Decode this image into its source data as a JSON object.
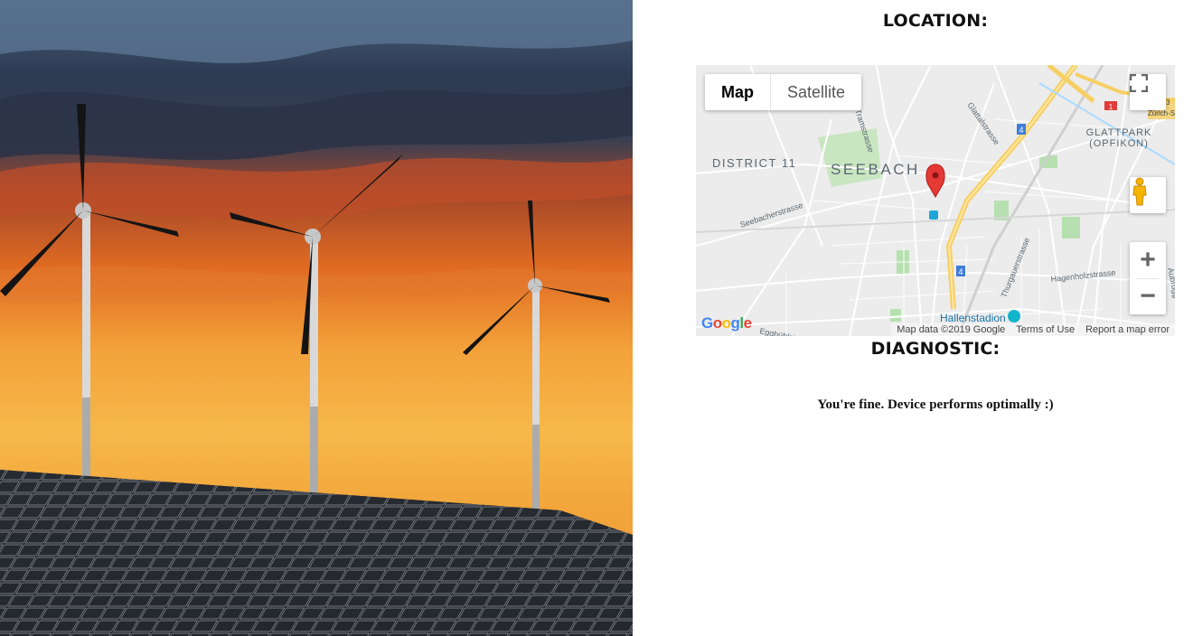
{
  "location_heading": "LOCATION:",
  "diagnostic_heading": "DIAGNOSTIC:",
  "diagnostic_message": "You're fine. Device performs optimally :)",
  "map": {
    "type_buttons": {
      "map": "Map",
      "satellite": "Satellite"
    },
    "labels": {
      "district": "DISTRICT 11",
      "neighborhood": "SEEBACH",
      "glattpark_1": "GLATTPARK",
      "glattpark_2": "(OPFIKON)",
      "seebacherstrasse": "Seebacherstrasse",
      "glattalstrasse": "Glattalstrasse",
      "hagenholzstrasse": "Hagenholzstrasse",
      "thurgauerstrasse": "Thurgauerstrasse",
      "hallenstadion": "Hallenstadion",
      "tramstrasse": "Tramstrasse",
      "aubrugg": "Aubrugg",
      "eggbuehl": "Eggbühlstrasse",
      "route_4a": "4",
      "route_4b": "4",
      "route_1": "1",
      "route_63": "63",
      "zurich": "Zürich-S"
    },
    "attribution": {
      "data": "Map data ©2019 Google",
      "terms": "Terms of Use",
      "report": "Report a map error"
    },
    "logo": "Google",
    "zoom_in": "+",
    "zoom_out": "−",
    "marker_icon": "map-pin-icon",
    "fullscreen_icon": "fullscreen-icon",
    "pegman_icon": "pegman-icon"
  },
  "colors": {
    "marker": "#e53935",
    "highway": "#f8d56b",
    "park": "#b7e0b0",
    "water": "#aadaff"
  }
}
